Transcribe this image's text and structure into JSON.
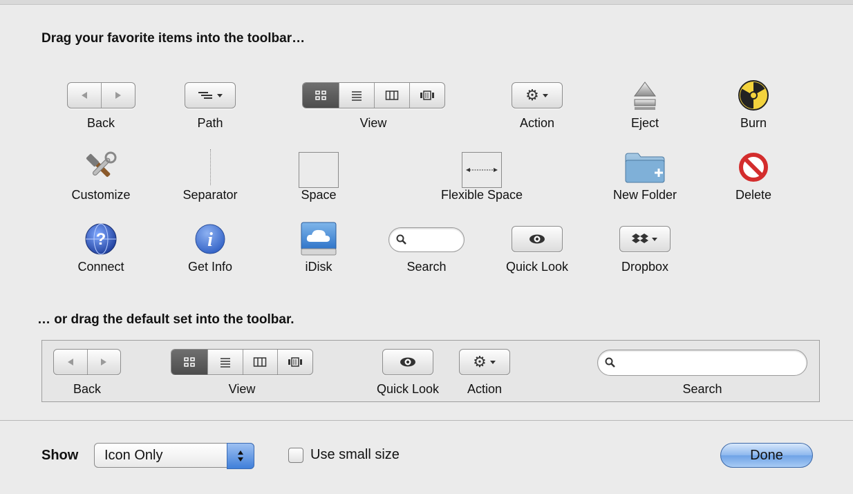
{
  "headings": {
    "favorites": "Drag your favorite items into the toolbar…",
    "default_set": "… or drag the default set into the toolbar."
  },
  "favorites": {
    "back": "Back",
    "path": "Path",
    "view": "View",
    "action": "Action",
    "eject": "Eject",
    "burn": "Burn",
    "customize": "Customize",
    "separator": "Separator",
    "space": "Space",
    "flexible_space": "Flexible Space",
    "new_folder": "New Folder",
    "delete": "Delete",
    "connect": "Connect",
    "get_info": "Get Info",
    "idisk": "iDisk",
    "search": "Search",
    "quick_look": "Quick Look",
    "dropbox": "Dropbox"
  },
  "default_set": {
    "back": "Back",
    "view": "View",
    "quick_look": "Quick Look",
    "action": "Action",
    "search": "Search"
  },
  "bottom": {
    "show_label": "Show",
    "show_value": "Icon Only",
    "small_size_label": "Use small size",
    "small_size_checked": false,
    "done_label": "Done"
  },
  "icons": {
    "back": "back-forward-icon",
    "path": "path-icon",
    "view": "view-modes-icon",
    "action": "gear-icon",
    "eject": "eject-icon",
    "burn": "burn-icon",
    "customize": "tools-icon",
    "new_folder": "folder-plus-icon",
    "delete": "prohibited-icon",
    "connect": "globe-question-icon",
    "get_info": "info-icon",
    "idisk": "idisk-cloud-icon",
    "search": "magnifier-icon",
    "quick_look": "eye-icon",
    "dropbox": "dropbox-icon"
  },
  "colors": {
    "accent_button": "#6ea2e6",
    "background": "#ebebeb"
  }
}
